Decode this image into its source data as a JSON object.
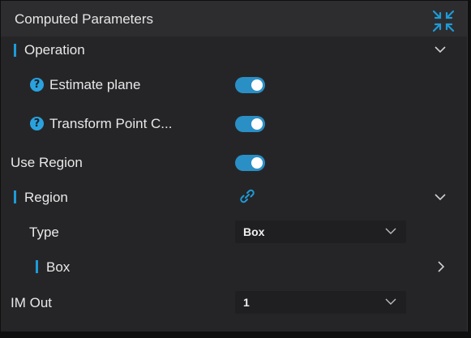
{
  "header": {
    "title": "Computed Parameters",
    "collapse_icon": "collapse-arrows-icon"
  },
  "colors": {
    "accent": "#1e9bd7",
    "toggle_on": "#2a8fc5",
    "panel_bg": "#252528",
    "header_bg": "#2d2d30"
  },
  "operation": {
    "label": "Operation",
    "items": [
      {
        "label": "Estimate plane",
        "enabled": true
      },
      {
        "label": "Transform Point C...",
        "enabled": true
      }
    ]
  },
  "use_region": {
    "label": "Use Region",
    "enabled": true
  },
  "region": {
    "label": "Region",
    "link_icon": "link-icon",
    "type_label": "Type",
    "type_value": "Box",
    "box": {
      "label": "Box"
    }
  },
  "im_out": {
    "label": "IM Out",
    "value": "1"
  }
}
